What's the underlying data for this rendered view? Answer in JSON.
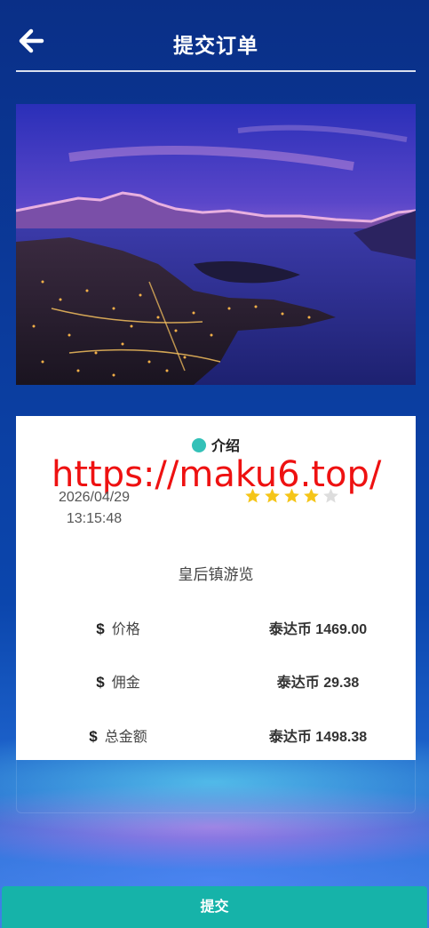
{
  "header": {
    "title": "提交订单",
    "back_icon": "arrow-left-icon"
  },
  "hero": {
    "description_icon": "landscape-photo"
  },
  "card": {
    "intro_label": "介绍",
    "watermark": "https://maku6.top/",
    "date": "2026/04/29",
    "time": "13:15:48",
    "rating": {
      "value": 4,
      "max": 5
    },
    "product_name": "皇后镇游览",
    "rows": [
      {
        "label": "价格",
        "value": "泰达币 1469.00"
      },
      {
        "label": "佣金",
        "value": "泰达币 29.38"
      },
      {
        "label": "总金额",
        "value": "泰达币 1498.38"
      }
    ],
    "currency_symbol": "$"
  },
  "footer": {
    "submit_label": "提交"
  },
  "colors": {
    "accent": "#16b3a9",
    "dot": "#33c1b8",
    "star_on": "#f5c518",
    "star_off": "#dddddd",
    "watermark": "#ee1111"
  }
}
